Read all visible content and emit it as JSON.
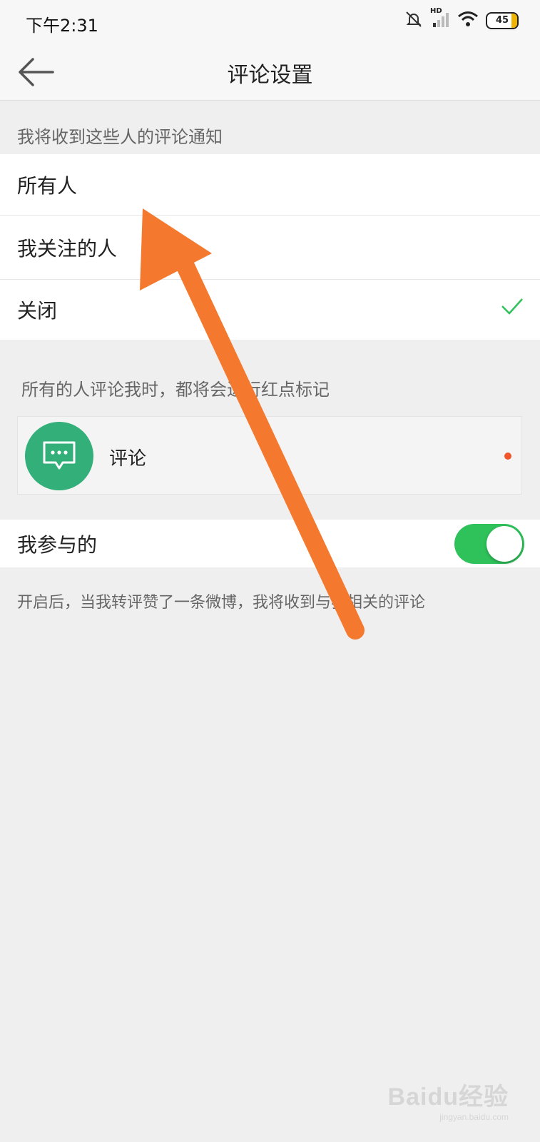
{
  "status_bar": {
    "time": "下午2:31",
    "network": "HD",
    "battery": "45"
  },
  "header": {
    "title": "评论设置"
  },
  "notify_section": {
    "label": "我将收到这些人的评论通知",
    "options": [
      "所有人",
      "我关注的人",
      "关闭"
    ],
    "selected": "关闭"
  },
  "mark_section": {
    "label": "所有的人评论我时，都将会进行红点标记",
    "item_label": "评论"
  },
  "participated": {
    "label": "我参与的",
    "enabled": true,
    "note": "开启后，当我转评赞了一条微博，我将收到与我相关的评论"
  },
  "watermark": {
    "text": "Baidu经验",
    "sub": "jingyan.baidu.com"
  },
  "colors": {
    "accent_green": "#2fc15a",
    "icon_green": "#33b07a",
    "arrow_orange": "#f4782e",
    "red_dot": "#f0552b"
  }
}
